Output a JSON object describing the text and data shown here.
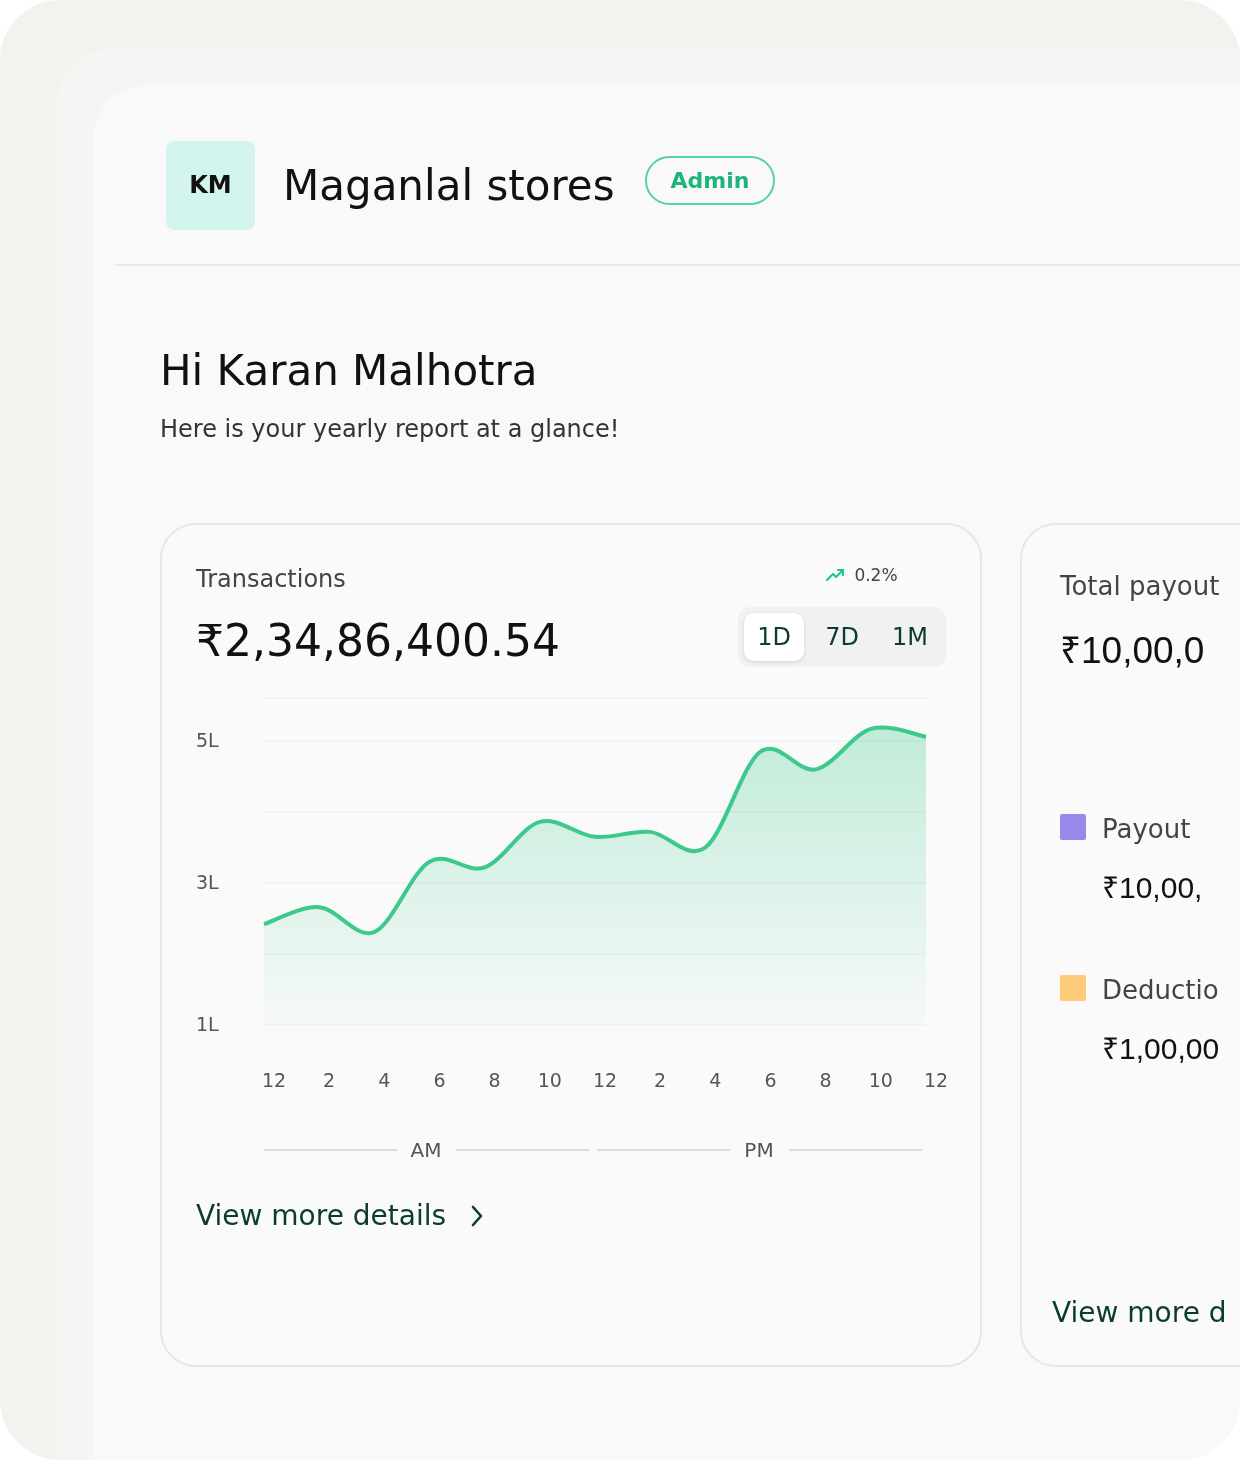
{
  "header": {
    "avatar_initials": "KM",
    "store_name": "Maganlal stores",
    "role_badge": "Admin"
  },
  "greeting": {
    "title": "Hi Karan Malhotra",
    "subtitle": "Here is your yearly report at a glance!"
  },
  "transactions_card": {
    "title": "Transactions",
    "trend": "0.2%",
    "amount": "₹2,34,86,400.54",
    "range_tabs": [
      {
        "label": "1D",
        "selected": true
      },
      {
        "label": "7D",
        "selected": false
      },
      {
        "label": "1M",
        "selected": false
      }
    ],
    "chart_data": {
      "type": "area",
      "categories": [
        "12",
        "2",
        "4",
        "6",
        "8",
        "10",
        "12",
        "2",
        "4",
        "6",
        "8",
        "10",
        "12"
      ],
      "series": [
        {
          "color": "#3cc98a",
          "values": [
            2.42,
            2.66,
            2.31,
            3.3,
            3.22,
            3.86,
            3.65,
            3.72,
            3.5,
            4.85,
            4.6,
            5.17,
            5.06
          ]
        }
      ],
      "ylim": [
        1,
        5.6
      ],
      "yticks": [
        {
          "value": 1,
          "label": "1L"
        },
        {
          "value": 3,
          "label": "3L"
        },
        {
          "value": 5,
          "label": "5L"
        }
      ]
    },
    "periods": [
      "AM",
      "PM"
    ],
    "link": "View more details"
  },
  "payout_card": {
    "title": "Total payout",
    "amount": "₹10,00,0",
    "legend": [
      {
        "label": "Payout",
        "value": "₹10,00,",
        "color": "#9a87ec"
      },
      {
        "label": "Deductio",
        "value": "₹1,00,00",
        "color": "#fecb78"
      }
    ],
    "link": "View more d"
  }
}
